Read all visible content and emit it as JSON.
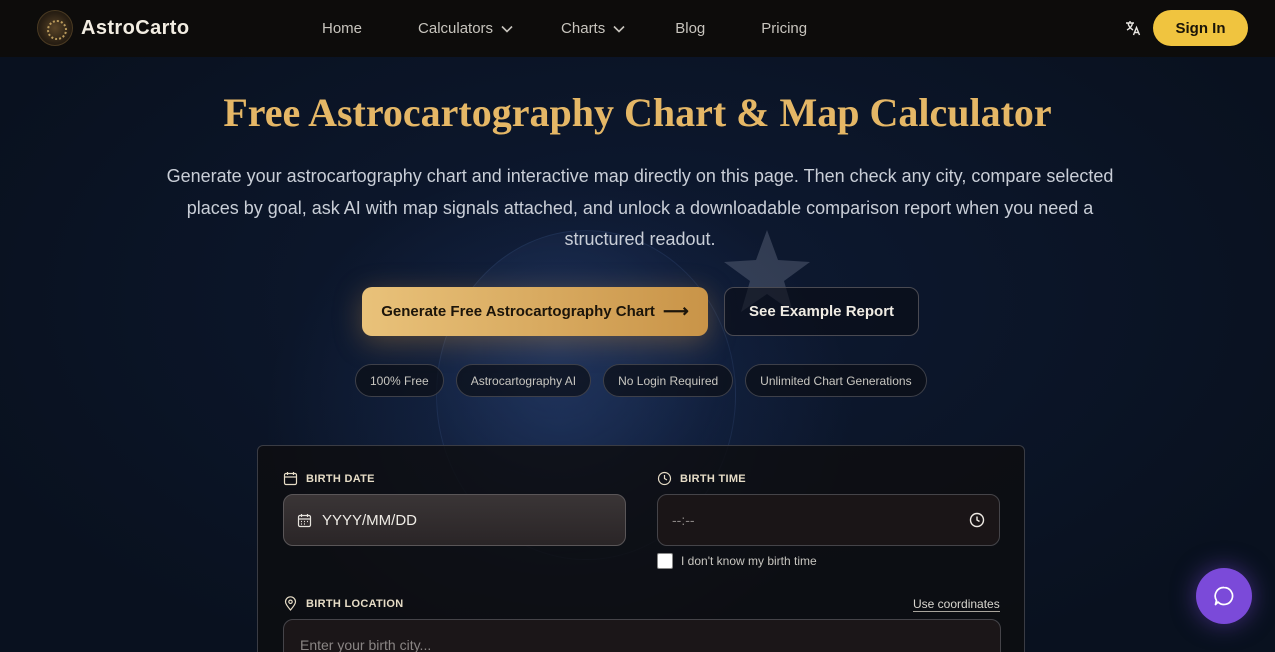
{
  "nav": {
    "brand": "AstroCarto",
    "links": [
      "Home",
      "Calculators",
      "Charts",
      "Blog",
      "Pricing"
    ],
    "sign_in": "Sign In",
    "translate_icon": "translate-icon"
  },
  "hero": {
    "title": "Free Astrocartography Chart & Map Calculator",
    "subtitle": "Generate your astrocartography chart and interactive map directly on this page. Then check any city, compare selected places by goal, ask AI with map signals attached, and unlock a downloadable comparison report when you need a structured readout.",
    "primary_cta": "Generate Free Astrocartography Chart",
    "secondary_cta": "See Example Report",
    "chips": [
      "100% Free",
      "Astrocartography AI",
      "No Login Required",
      "Unlimited Chart Generations"
    ]
  },
  "form": {
    "birth_date_label": "BIRTH DATE",
    "birth_date_value": "YYYY/MM/DD",
    "birth_time_label": "BIRTH TIME",
    "birth_time_value": "--:--",
    "unknown_time": "I don't know my birth time",
    "birth_location_label": "BIRTH LOCATION",
    "use_coordinates": "Use coordinates",
    "location_placeholder": "Enter your birth city..."
  },
  "colors": {
    "accent_gold": "#e5b766",
    "sign_in_yellow": "#f0c43f",
    "chat_purple": "#7b4ad9"
  }
}
